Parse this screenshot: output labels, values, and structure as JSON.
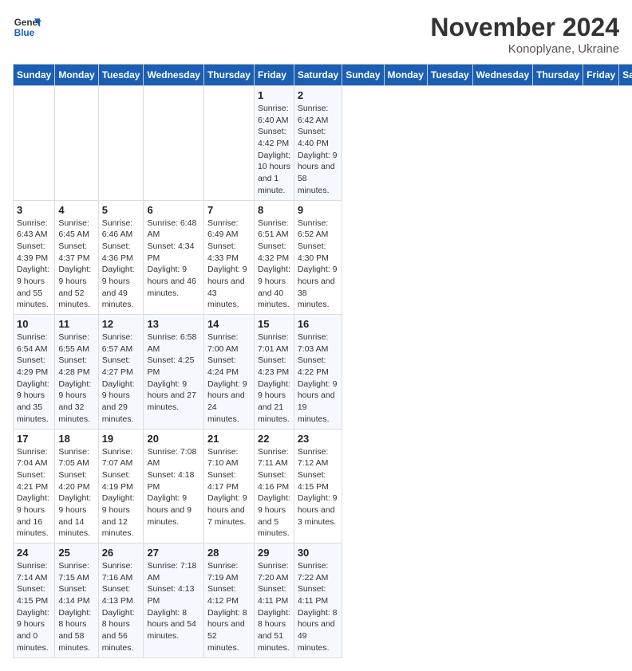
{
  "logo": {
    "line1": "General",
    "line2": "Blue"
  },
  "title": "November 2024",
  "subtitle": "Konoplyane, Ukraine",
  "days_of_week": [
    "Sunday",
    "Monday",
    "Tuesday",
    "Wednesday",
    "Thursday",
    "Friday",
    "Saturday"
  ],
  "weeks": [
    [
      {
        "day": "",
        "info": ""
      },
      {
        "day": "",
        "info": ""
      },
      {
        "day": "",
        "info": ""
      },
      {
        "day": "",
        "info": ""
      },
      {
        "day": "",
        "info": ""
      },
      {
        "day": "1",
        "info": "Sunrise: 6:40 AM\nSunset: 4:42 PM\nDaylight: 10 hours and 1 minute."
      },
      {
        "day": "2",
        "info": "Sunrise: 6:42 AM\nSunset: 4:40 PM\nDaylight: 9 hours and 58 minutes."
      }
    ],
    [
      {
        "day": "3",
        "info": "Sunrise: 6:43 AM\nSunset: 4:39 PM\nDaylight: 9 hours and 55 minutes."
      },
      {
        "day": "4",
        "info": "Sunrise: 6:45 AM\nSunset: 4:37 PM\nDaylight: 9 hours and 52 minutes."
      },
      {
        "day": "5",
        "info": "Sunrise: 6:46 AM\nSunset: 4:36 PM\nDaylight: 9 hours and 49 minutes."
      },
      {
        "day": "6",
        "info": "Sunrise: 6:48 AM\nSunset: 4:34 PM\nDaylight: 9 hours and 46 minutes."
      },
      {
        "day": "7",
        "info": "Sunrise: 6:49 AM\nSunset: 4:33 PM\nDaylight: 9 hours and 43 minutes."
      },
      {
        "day": "8",
        "info": "Sunrise: 6:51 AM\nSunset: 4:32 PM\nDaylight: 9 hours and 40 minutes."
      },
      {
        "day": "9",
        "info": "Sunrise: 6:52 AM\nSunset: 4:30 PM\nDaylight: 9 hours and 38 minutes."
      }
    ],
    [
      {
        "day": "10",
        "info": "Sunrise: 6:54 AM\nSunset: 4:29 PM\nDaylight: 9 hours and 35 minutes."
      },
      {
        "day": "11",
        "info": "Sunrise: 6:55 AM\nSunset: 4:28 PM\nDaylight: 9 hours and 32 minutes."
      },
      {
        "day": "12",
        "info": "Sunrise: 6:57 AM\nSunset: 4:27 PM\nDaylight: 9 hours and 29 minutes."
      },
      {
        "day": "13",
        "info": "Sunrise: 6:58 AM\nSunset: 4:25 PM\nDaylight: 9 hours and 27 minutes."
      },
      {
        "day": "14",
        "info": "Sunrise: 7:00 AM\nSunset: 4:24 PM\nDaylight: 9 hours and 24 minutes."
      },
      {
        "day": "15",
        "info": "Sunrise: 7:01 AM\nSunset: 4:23 PM\nDaylight: 9 hours and 21 minutes."
      },
      {
        "day": "16",
        "info": "Sunrise: 7:03 AM\nSunset: 4:22 PM\nDaylight: 9 hours and 19 minutes."
      }
    ],
    [
      {
        "day": "17",
        "info": "Sunrise: 7:04 AM\nSunset: 4:21 PM\nDaylight: 9 hours and 16 minutes."
      },
      {
        "day": "18",
        "info": "Sunrise: 7:05 AM\nSunset: 4:20 PM\nDaylight: 9 hours and 14 minutes."
      },
      {
        "day": "19",
        "info": "Sunrise: 7:07 AM\nSunset: 4:19 PM\nDaylight: 9 hours and 12 minutes."
      },
      {
        "day": "20",
        "info": "Sunrise: 7:08 AM\nSunset: 4:18 PM\nDaylight: 9 hours and 9 minutes."
      },
      {
        "day": "21",
        "info": "Sunrise: 7:10 AM\nSunset: 4:17 PM\nDaylight: 9 hours and 7 minutes."
      },
      {
        "day": "22",
        "info": "Sunrise: 7:11 AM\nSunset: 4:16 PM\nDaylight: 9 hours and 5 minutes."
      },
      {
        "day": "23",
        "info": "Sunrise: 7:12 AM\nSunset: 4:15 PM\nDaylight: 9 hours and 3 minutes."
      }
    ],
    [
      {
        "day": "24",
        "info": "Sunrise: 7:14 AM\nSunset: 4:15 PM\nDaylight: 9 hours and 0 minutes."
      },
      {
        "day": "25",
        "info": "Sunrise: 7:15 AM\nSunset: 4:14 PM\nDaylight: 8 hours and 58 minutes."
      },
      {
        "day": "26",
        "info": "Sunrise: 7:16 AM\nSunset: 4:13 PM\nDaylight: 8 hours and 56 minutes."
      },
      {
        "day": "27",
        "info": "Sunrise: 7:18 AM\nSunset: 4:13 PM\nDaylight: 8 hours and 54 minutes."
      },
      {
        "day": "28",
        "info": "Sunrise: 7:19 AM\nSunset: 4:12 PM\nDaylight: 8 hours and 52 minutes."
      },
      {
        "day": "29",
        "info": "Sunrise: 7:20 AM\nSunset: 4:11 PM\nDaylight: 8 hours and 51 minutes."
      },
      {
        "day": "30",
        "info": "Sunrise: 7:22 AM\nSunset: 4:11 PM\nDaylight: 8 hours and 49 minutes."
      }
    ]
  ]
}
